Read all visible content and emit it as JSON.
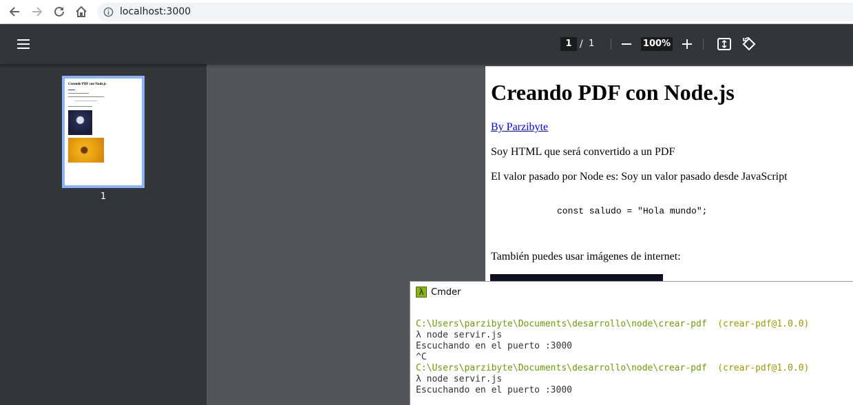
{
  "browser": {
    "url": "localhost:3000",
    "icons": [
      "back-arrow-icon",
      "forward-arrow-icon",
      "reload-icon",
      "home-icon",
      "info-icon"
    ]
  },
  "pdf_toolbar": {
    "current_page": "1",
    "page_separator": "/",
    "total_pages": "1",
    "zoom": "100%"
  },
  "sidebar": {
    "thumbnail_label": "1",
    "thumbnail_title": "Creando PDF con Node.js"
  },
  "pdf_page": {
    "title": "Creando PDF con Node.js",
    "link": "By Parzibyte",
    "paragraph1": "Soy HTML que será convertido a un PDF",
    "paragraph2": "El valor pasado por Node es: Soy un valor pasado desde JavaScript",
    "code": "const saludo = \"Hola mundo\";",
    "paragraph3": "También puedes usar imágenes de internet:"
  },
  "cmder": {
    "title": "Cmder",
    "logo": "λ",
    "lines": [
      {
        "path": "C:\\Users\\parzibyte\\Documents\\desarrollo\\node\\crear-pdf",
        "git": "  (crear-pdf@1.0.0)"
      },
      {
        "text": "λ node servir.js"
      },
      {
        "text": "Escuchando en el puerto :3000"
      },
      {
        "text": "^C"
      },
      {
        "path": "C:\\Users\\parzibyte\\Documents\\desarrollo\\node\\crear-pdf",
        "git": "  (crear-pdf@1.0.0)"
      },
      {
        "text": "λ node servir.js"
      },
      {
        "text": "Escuchando en el puerto :3000"
      }
    ]
  },
  "colors": {
    "toolbar_bg": "#323639",
    "viewer_bg": "#525659",
    "thumb_border": "#8ab4f8",
    "link": "#0000ee",
    "term_path": "#6c9a0c",
    "term_git": "#999a00"
  }
}
